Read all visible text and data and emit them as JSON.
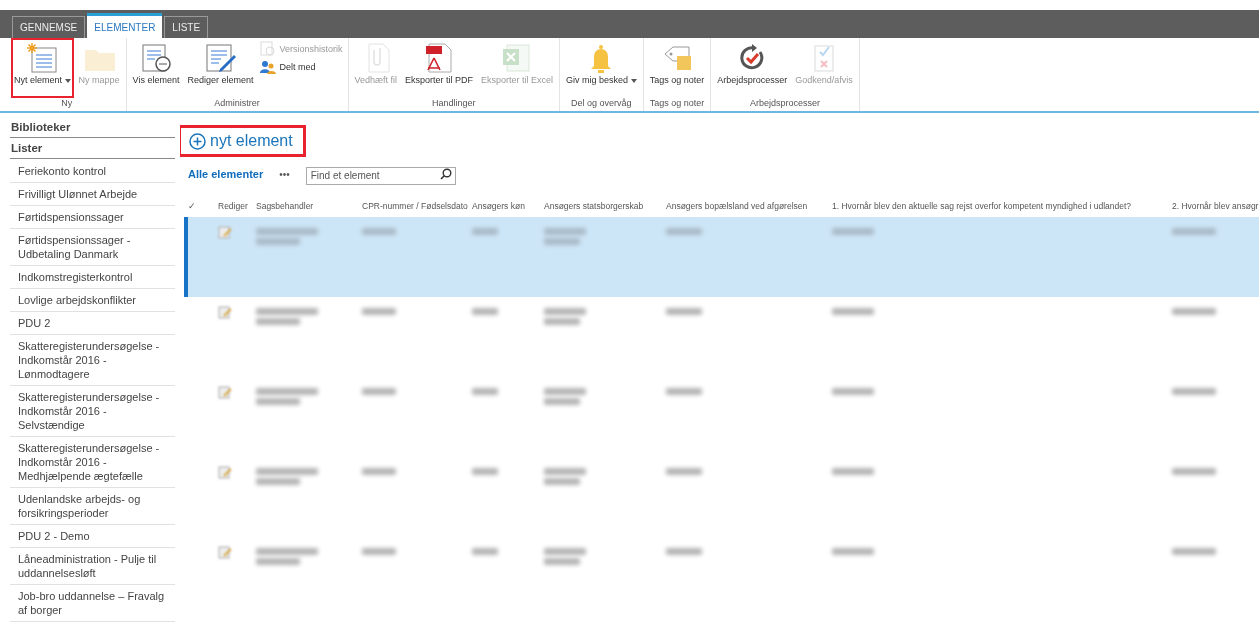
{
  "tabs": [
    {
      "label": "GENNEMSE",
      "selected": false
    },
    {
      "label": "ELEMENTER",
      "selected": true
    },
    {
      "label": "LISTE",
      "selected": false
    }
  ],
  "ribbon": {
    "groups": [
      {
        "label": "Ny",
        "buttons": [
          {
            "label": "Nyt element",
            "kind": "large",
            "dropdown": true,
            "disabled": false,
            "highlighted": true
          },
          {
            "label": "Ny mappe",
            "kind": "large",
            "dropdown": false,
            "disabled": true,
            "highlighted": false
          }
        ]
      },
      {
        "label": "Administrer",
        "buttons": [
          {
            "label": "Vis element",
            "kind": "large",
            "dropdown": false,
            "disabled": false,
            "highlighted": false
          },
          {
            "label": "Rediger element",
            "kind": "large",
            "dropdown": false,
            "disabled": false,
            "highlighted": false
          },
          {
            "label": "Versionshistorik",
            "kind": "small",
            "dropdown": false,
            "disabled": true,
            "highlighted": false
          },
          {
            "label": "Delt med",
            "kind": "small",
            "dropdown": false,
            "disabled": false,
            "highlighted": false
          }
        ]
      },
      {
        "label": "Handlinger",
        "buttons": [
          {
            "label": "Vedhæft fil",
            "kind": "large",
            "dropdown": false,
            "disabled": true,
            "highlighted": false
          },
          {
            "label": "Eksporter til PDF",
            "kind": "large",
            "dropdown": false,
            "disabled": false,
            "highlighted": false
          },
          {
            "label": "Eksporter til Excel",
            "kind": "large",
            "dropdown": false,
            "disabled": true,
            "highlighted": false
          }
        ]
      },
      {
        "label": "Del og overvåg",
        "buttons": [
          {
            "label": "Giv mig besked",
            "kind": "large",
            "dropdown": true,
            "disabled": false,
            "highlighted": false
          }
        ]
      },
      {
        "label": "Tags og noter",
        "buttons": [
          {
            "label": "Tags og noter",
            "kind": "large",
            "dropdown": false,
            "disabled": false,
            "highlighted": false
          }
        ]
      },
      {
        "label": "Arbejdsprocesser",
        "buttons": [
          {
            "label": "Arbejdsprocesser",
            "kind": "large",
            "dropdown": false,
            "disabled": false,
            "highlighted": false
          },
          {
            "label": "Godkend/afvis",
            "kind": "large",
            "dropdown": false,
            "disabled": true,
            "highlighted": false
          }
        ]
      }
    ]
  },
  "sidebar": {
    "sections": [
      {
        "label": "Biblioteker"
      },
      {
        "label": "Lister",
        "items": [
          "Feriekonto kontrol",
          "Frivilligt Ulønnet Arbejde",
          "Førtidspensionssager",
          "Førtidspensionssager - Udbetaling Danmark",
          "Indkomstregisterkontrol",
          "Lovlige arbejdskonflikter",
          "PDU 2",
          "Skatteregisterundersøgelse - Indkomstår 2016 - Lønmodtagere",
          "Skatteregisterundersøgelse - Indkomstår 2016 - Selvstændige",
          "Skatteregisterundersøgelse - Indkomstår 2016 - Medhjælpende ægtefælle",
          "Udenlandske arbejds- og forsikringsperioder",
          "PDU 2 - Demo",
          "Låneadministration - Pulje til uddannelsesløft",
          "Job-bro uddannelse – Fravalg af borger"
        ]
      }
    ]
  },
  "new_item_link": {
    "label": "nyt element",
    "highlighted": true
  },
  "view": {
    "name": "Alle elementer",
    "more": "•••",
    "search": {
      "placeholder": "Find et element"
    }
  },
  "table": {
    "select_all": "✓",
    "columns": [
      "Rediger",
      "Sagsbehandler",
      "CPR-nummer / Fødselsdato",
      "Ansøgers køn",
      "Ansøgers statsborgerskab",
      "Ansøgers bopælsland ved afgørelsen",
      "1. Hvornår blev den aktuelle sag rejst overfor kompetent myndighed i udlandet?",
      "2. Hvornår blev ansøgr"
    ],
    "rows": [
      {
        "selected": true
      },
      {
        "selected": false
      },
      {
        "selected": false
      },
      {
        "selected": false
      },
      {
        "selected": false
      }
    ]
  }
}
